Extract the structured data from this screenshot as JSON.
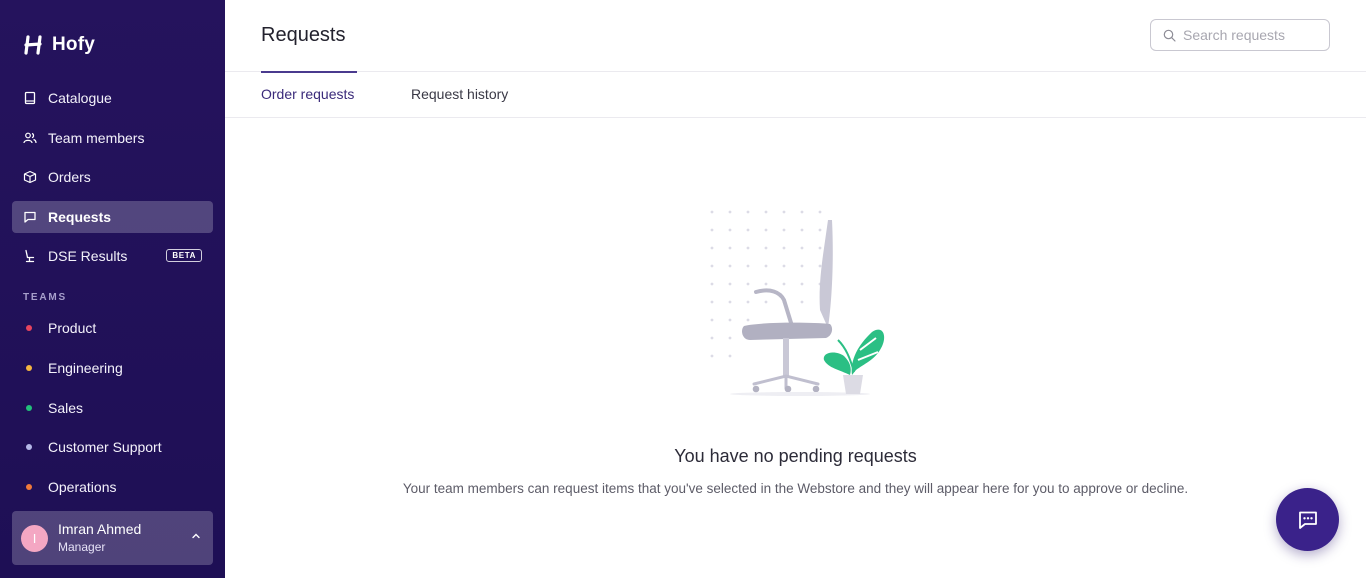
{
  "brand": {
    "name": "Hofy"
  },
  "sidebar": {
    "nav": [
      {
        "label": "Catalogue",
        "icon": "book-icon"
      },
      {
        "label": "Team members",
        "icon": "users-icon"
      },
      {
        "label": "Orders",
        "icon": "box-icon"
      },
      {
        "label": "Requests",
        "icon": "message-icon",
        "active": true
      },
      {
        "label": "DSE Results",
        "icon": "chair-icon",
        "badge": "BETA"
      }
    ],
    "teams_title": "TEAMS",
    "teams": [
      {
        "label": "Product",
        "color": "#e8455e"
      },
      {
        "label": "Engineering",
        "color": "#f5b640"
      },
      {
        "label": "Sales",
        "color": "#22c07a"
      },
      {
        "label": "Customer Support",
        "color": "#b5b8e8"
      },
      {
        "label": "Operations",
        "color": "#f07a3a"
      }
    ],
    "user": {
      "initial": "I",
      "name": "Imran Ahmed",
      "role": "Manager"
    }
  },
  "header": {
    "title": "Requests",
    "search_placeholder": "Search requests"
  },
  "tabs": [
    {
      "label": "Order requests",
      "active": true
    },
    {
      "label": "Request history",
      "active": false
    }
  ],
  "empty_state": {
    "title": "You have no pending requests",
    "description": "Your team members can request items that you've selected in the Webstore and they will appear here for you to approve or decline."
  },
  "colors": {
    "sidebar_bg": "#25135d",
    "accent": "#3a228a",
    "plant": "#2bbf84"
  }
}
